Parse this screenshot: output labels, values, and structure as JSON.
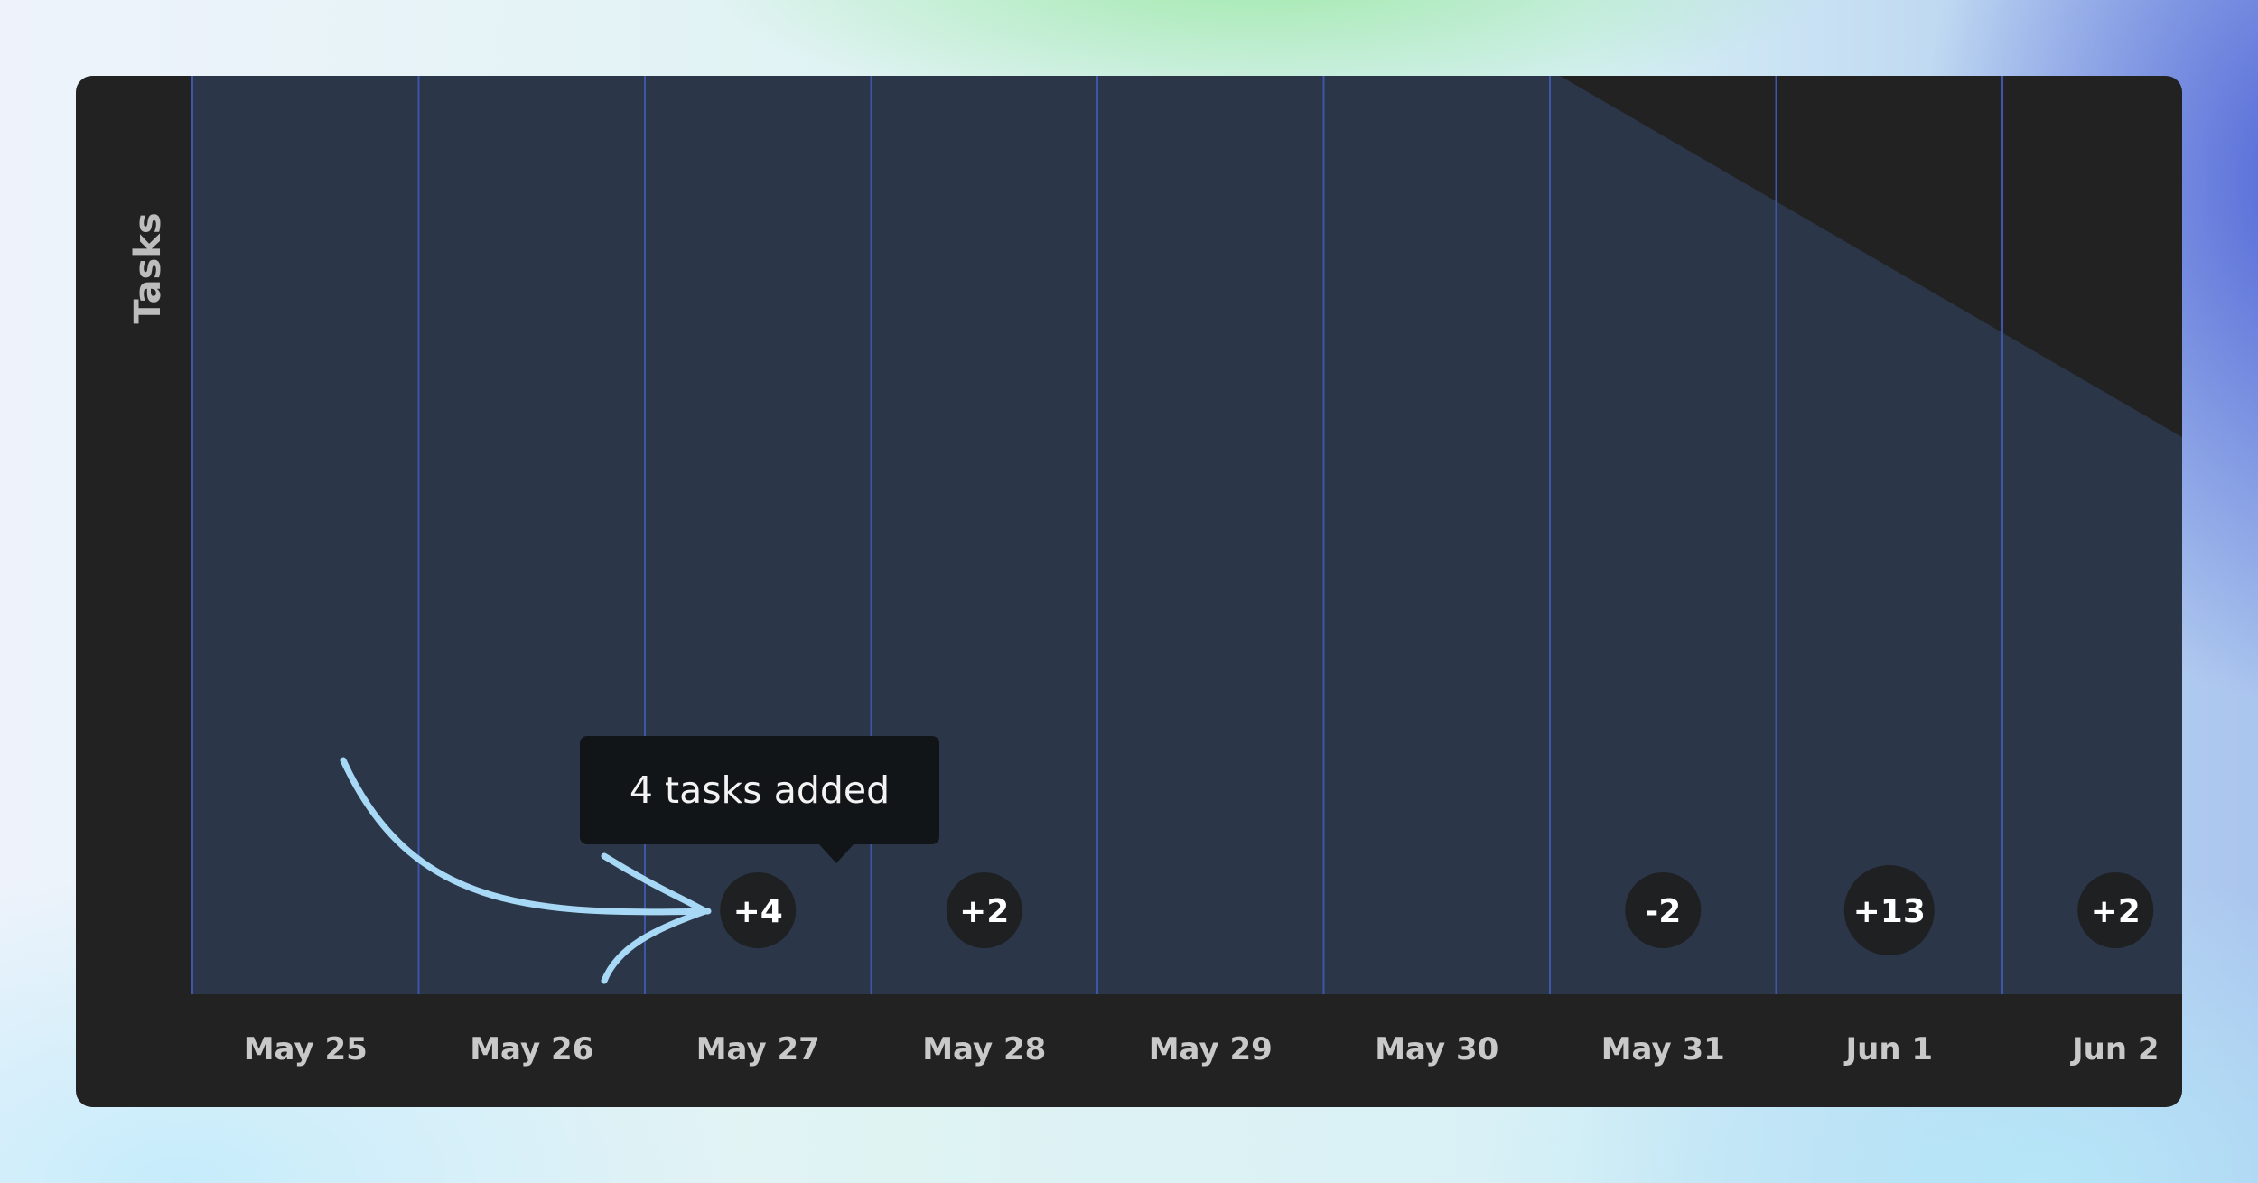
{
  "chart_data": {
    "type": "bar",
    "ylabel": "Tasks",
    "xlabel": "",
    "categories": [
      "May 25",
      "May 26",
      "May 27",
      "May 28",
      "May 29",
      "May 30",
      "May 31",
      "Jun 1",
      "Jun 2"
    ],
    "daily_changes": [
      "",
      "",
      "+4",
      "+2",
      "",
      "",
      "-2",
      "+13",
      "+2"
    ],
    "grid": true,
    "colors": {
      "plot_area": "#2b3749",
      "gridline": "#3d56a8",
      "badge": "#1e2022",
      "arrow": "#a7d8f5"
    }
  },
  "tooltip": {
    "text": "4 tasks added"
  }
}
